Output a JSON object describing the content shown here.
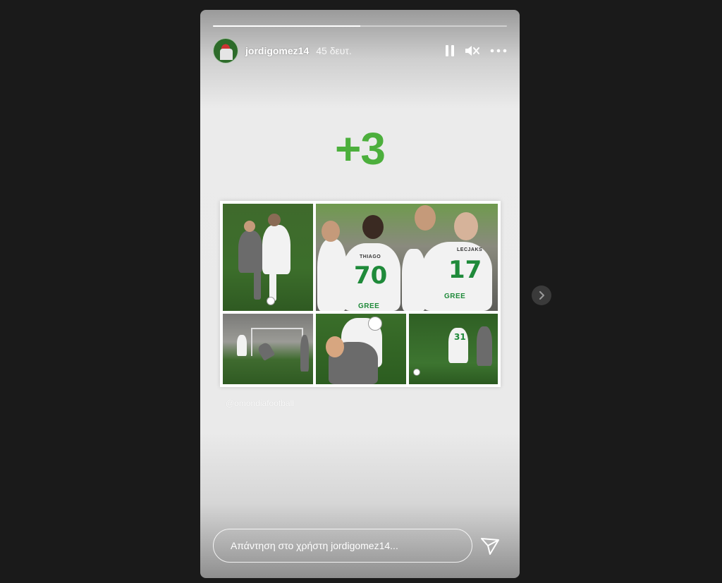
{
  "story": {
    "progress": 0.5,
    "username": "jordigomez14",
    "time": "45 δευτ.",
    "content_text": "+3",
    "accent_color": "#4caf3c",
    "watermark": "@omondiafootball",
    "jersey_names": [
      "THIAGO",
      "LECJAKS"
    ],
    "jersey_numbers": [
      "70",
      "17",
      "31"
    ],
    "sponsor": "GREE"
  },
  "controls": {
    "pause_icon": "pause-icon",
    "mute_icon": "speaker-muted-icon",
    "more_icon": "more-icon"
  },
  "reply": {
    "placeholder": "Απάντηση στο χρήστη jordigomez14...",
    "send_icon": "send-icon"
  },
  "nav": {
    "next_icon": "chevron-right-icon"
  }
}
